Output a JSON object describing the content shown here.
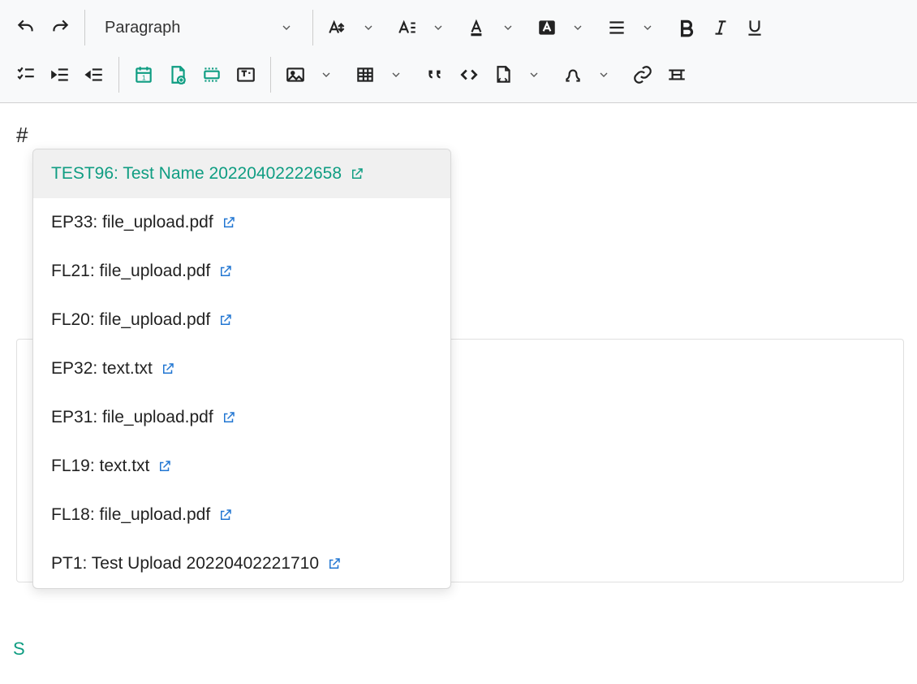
{
  "toolbar": {
    "format_label": "Paragraph",
    "row1_icons": [
      "undo",
      "redo",
      "format-select",
      "font-size",
      "chev",
      "font-family",
      "chev",
      "text-color",
      "chev",
      "highlight",
      "chev",
      "align",
      "chev",
      "bold",
      "italic",
      "underline"
    ],
    "row2_icons": [
      "checklist",
      "indent",
      "outdent",
      "sep",
      "date",
      "page-add",
      "frame",
      "text-block",
      "sep",
      "image",
      "chev",
      "table",
      "chev",
      "quote",
      "code",
      "code-block",
      "chev",
      "special-char",
      "chev",
      "link",
      "anchor"
    ]
  },
  "editor": {
    "typed": "#"
  },
  "save_text": "S",
  "suggestions": [
    {
      "label": "TEST96: Test Name 20220402222658",
      "active": true
    },
    {
      "label": "EP33: file_upload.pdf",
      "active": false
    },
    {
      "label": "FL21: file_upload.pdf",
      "active": false
    },
    {
      "label": "FL20: file_upload.pdf",
      "active": false
    },
    {
      "label": "EP32: text.txt",
      "active": false
    },
    {
      "label": "EP31: file_upload.pdf",
      "active": false
    },
    {
      "label": "FL19: text.txt",
      "active": false
    },
    {
      "label": "FL18: file_upload.pdf",
      "active": false
    },
    {
      "label": "PT1: Test Upload 20220402221710",
      "active": false
    }
  ]
}
